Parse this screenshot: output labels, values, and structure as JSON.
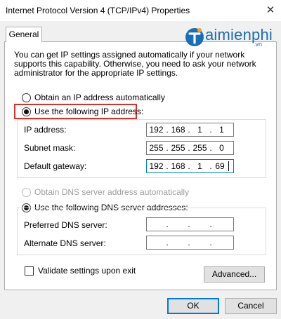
{
  "window": {
    "title": "Internet Protocol Version 4 (TCP/IPv4) Properties",
    "close_glyph": "✕"
  },
  "tabs": [
    {
      "label": "General"
    }
  ],
  "watermark": {
    "text": "aimienphi",
    "sub": ".vn"
  },
  "description": "You can get IP settings assigned automatically if your network supports this capability. Otherwise, you need to ask your network administrator for the appropriate IP settings.",
  "ip_mode": {
    "auto_label": "Obtain an IP address automatically",
    "manual_label": "Use the following IP address:",
    "selected": "manual"
  },
  "ip_fields": {
    "ip_address": {
      "label": "IP address:",
      "octets": [
        "192",
        "168",
        "1",
        "1"
      ]
    },
    "subnet_mask": {
      "label": "Subnet mask:",
      "octets": [
        "255",
        "255",
        "255",
        "0"
      ]
    },
    "default_gateway": {
      "label": "Default gateway:",
      "octets": [
        "192",
        "168",
        "1",
        "69"
      ]
    }
  },
  "dns_mode": {
    "auto_label": "Obtain DNS server address automatically",
    "manual_label": "Use the following DNS server addresses:",
    "selected": "manual",
    "auto_disabled": true
  },
  "dns_fields": {
    "preferred": {
      "label": "Preferred DNS server:",
      "octets": [
        "",
        "",
        "",
        ""
      ]
    },
    "alternate": {
      "label": "Alternate DNS server:",
      "octets": [
        "",
        "",
        "",
        ""
      ]
    }
  },
  "validate": {
    "label": "Validate settings upon exit",
    "checked": false
  },
  "buttons": {
    "advanced": "Advanced...",
    "ok": "OK",
    "cancel": "Cancel"
  },
  "icons": {
    "close": "close-icon",
    "watermark": "taimienphi-logo-icon",
    "radio": "radio-icon",
    "checkbox": "checkbox-icon"
  },
  "colors": {
    "highlight_box": "#d9302c",
    "focus_border": "#0078d7",
    "watermark": "#1a6eb7"
  }
}
